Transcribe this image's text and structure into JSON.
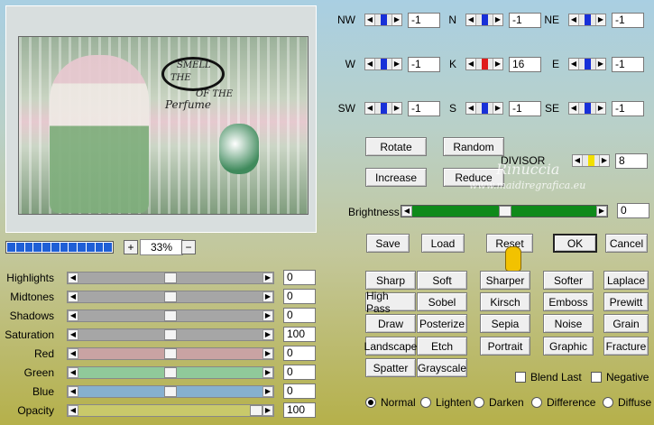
{
  "preview": {
    "logo_lines": [
      "SMELL",
      "THE",
      "OF THE"
    ],
    "script_text": "Perfume"
  },
  "zoom": {
    "value": "33%",
    "plus": "+",
    "minus": "−",
    "progress_segments": 12
  },
  "sliders": [
    {
      "label": "Highlights",
      "value": "0",
      "track_color": "#a6a6a6",
      "thumb_pct": 0.5
    },
    {
      "label": "Midtones",
      "value": "0",
      "track_color": "#a6a6a6",
      "thumb_pct": 0.5
    },
    {
      "label": "Shadows",
      "value": "0",
      "track_color": "#a6a6a6",
      "thumb_pct": 0.5
    },
    {
      "label": "Saturation",
      "value": "100",
      "track_color": "#a6a6a6",
      "thumb_pct": 0.5
    },
    {
      "label": "Red",
      "value": "0",
      "track_color": "#c9a3a3",
      "thumb_pct": 0.5
    },
    {
      "label": "Green",
      "value": "0",
      "track_color": "#90c99a",
      "thumb_pct": 0.5
    },
    {
      "label": "Blue",
      "value": "0",
      "track_color": "#86b0cf",
      "thumb_pct": 0.5
    },
    {
      "label": "Opacity",
      "value": "100",
      "track_color": "#c9c96a",
      "thumb_pct": 1.0
    }
  ],
  "matrix": [
    {
      "label": "NW",
      "value": "-1",
      "mark": "#1830d8"
    },
    {
      "label": "N",
      "value": "-1",
      "mark": "#1830d8"
    },
    {
      "label": "NE",
      "value": "-1",
      "mark": "#1830d8"
    },
    {
      "label": "W",
      "value": "-1",
      "mark": "#1830d8"
    },
    {
      "label": "K",
      "value": "16",
      "mark": "#e01b1b"
    },
    {
      "label": "E",
      "value": "-1",
      "mark": "#1830d8"
    },
    {
      "label": "SW",
      "value": "-1",
      "mark": "#1830d8"
    },
    {
      "label": "S",
      "value": "-1",
      "mark": "#1830d8"
    },
    {
      "label": "SE",
      "value": "-1",
      "mark": "#1830d8"
    }
  ],
  "buttons": {
    "rotate": "Rotate",
    "random": "Random",
    "increase": "Increase",
    "reduce": "Reduce",
    "save": "Save",
    "load": "Load",
    "reset": "Reset",
    "ok": "OK",
    "cancel": "Cancel"
  },
  "divisor": {
    "label": "DIVISOR",
    "value": "8",
    "mark": "#f2e000"
  },
  "brightness": {
    "label": "Brightness",
    "value": "0",
    "track_color": "#0f8a1a",
    "thumb_pct": 0.5
  },
  "watermark": {
    "line1": "Rinuccia",
    "line2": "www.maidiregrafica.eu"
  },
  "presets": [
    [
      "Sharp",
      "Soft",
      "Sharper",
      "Softer",
      "Laplace"
    ],
    [
      "High Pass",
      "Sobel",
      "Kirsch",
      "Emboss",
      "Prewitt"
    ],
    [
      "Draw",
      "Posterize",
      "Sepia",
      "Noise",
      "Grain"
    ],
    [
      "Landscape",
      "Etch",
      "Portrait",
      "Graphic",
      "Fracture"
    ],
    [
      "Spatter",
      "Grayscale"
    ]
  ],
  "checkboxes": {
    "blend_last": "Blend Last",
    "negative": "Negative"
  },
  "modes": [
    "Normal",
    "Lighten",
    "Darken",
    "Difference",
    "Diffuse"
  ],
  "selected_mode": "Normal"
}
